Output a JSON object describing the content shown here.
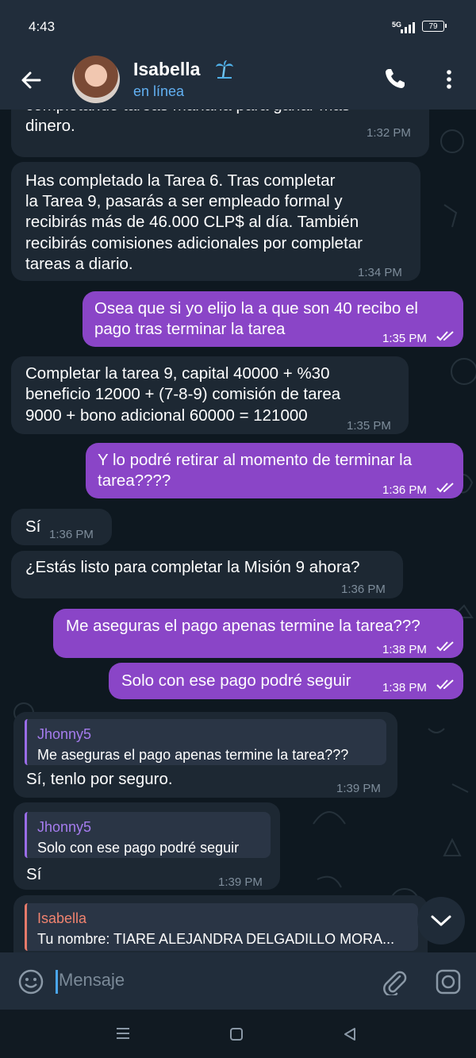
{
  "status": {
    "time": "4:43",
    "network": "5G",
    "battery": "79"
  },
  "header": {
    "name": "Isabella",
    "status": "en línea",
    "name_icon": "palm-tree-icon"
  },
  "messages": [
    {
      "lines": [
        "completando tareas mañana para ganar más",
        "dinero."
      ],
      "time": "1:32 PM"
    },
    {
      "lines": [
        "Has completado la Tarea 6. Tras completar",
        "la Tarea 9, pasarás a ser empleado formal y",
        "recibirás más de 46.000 CLP$ al día. También",
        "recibirás comisiones adicionales por completar",
        "tareas a diario."
      ],
      "time": "1:34 PM"
    },
    {
      "lines": [
        "Osea que si yo elijo la a que son 40 recibo el",
        "pago tras terminar la tarea"
      ],
      "time": "1:35 PM"
    },
    {
      "lines": [
        "Completar la tarea 9, capital 40000 + %30",
        "beneficio 12000 + (7-8-9) comisión de tarea",
        "9000 + bono adicional 60000 = 121000"
      ],
      "time": "1:35 PM"
    },
    {
      "lines": [
        "Y lo podré retirar al momento de terminar la",
        "tarea????"
      ],
      "time": "1:36 PM"
    },
    {
      "lines": [
        "Sí"
      ],
      "time": "1:36 PM"
    },
    {
      "lines": [
        "¿Estás listo para completar la Misión 9 ahora?"
      ],
      "time": "1:36 PM"
    },
    {
      "lines": [
        "Me aseguras el pago apenas termine la tarea???"
      ],
      "time": "1:38 PM"
    },
    {
      "lines": [
        "Solo con ese pago podré seguir"
      ],
      "time": "1:38 PM"
    },
    {
      "reply_name": "Jhonny5",
      "reply_text": "Me aseguras el pago apenas termine la tarea???",
      "lines": [
        "Sí, tenlo por seguro."
      ],
      "time": "1:39 PM"
    },
    {
      "reply_name": "Jhonny5",
      "reply_text": "Solo con ese pago podré seguir",
      "lines": [
        "Sí"
      ],
      "time": "1:39 PM"
    },
    {
      "reply_name": "Isabella",
      "reply_text": "Tu nombre: TIARE ALEJANDRA DELGADILLO MORA..."
    }
  ],
  "composer": {
    "placeholder": "Mensaje"
  },
  "colors": {
    "incoming": "#1d2833",
    "outgoing": "#8a45c7",
    "header": "#212d3b",
    "link": "#62b0f2"
  }
}
